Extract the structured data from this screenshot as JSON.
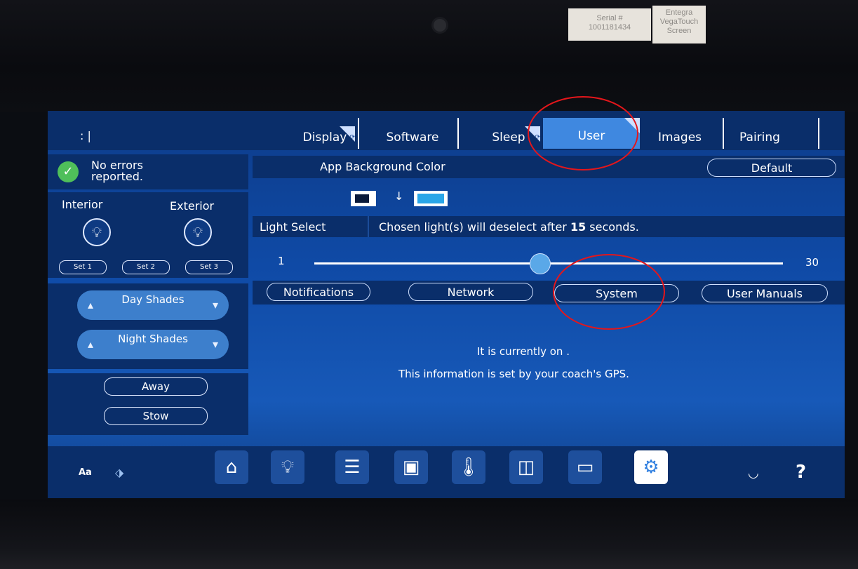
{
  "stickers": {
    "serial_label": "Serial #",
    "serial_number": "1001181434",
    "model_line1": "Entegra",
    "model_line2": "VegaTouch",
    "model_line3": "Screen"
  },
  "header": {
    "clock_text": ":       |"
  },
  "status": {
    "text": "No errors reported."
  },
  "lights": {
    "interior_label": "Interior",
    "exterior_label": "Exterior",
    "set_buttons": [
      "Set 1",
      "Set 2",
      "Set 3"
    ]
  },
  "shades": {
    "day_label": "Day Shades",
    "night_label": "Night Shades"
  },
  "modes": {
    "away_label": "Away",
    "stow_label": "Stow"
  },
  "tabs": [
    {
      "label": "Display"
    },
    {
      "label": "Software"
    },
    {
      "label": "Sleep"
    },
    {
      "label": "User"
    },
    {
      "label": "Images"
    },
    {
      "label": "Pairing"
    }
  ],
  "active_tab": "User",
  "background": {
    "label": "App Background Color",
    "default_button": "Default",
    "from_color": "#0a1a3a",
    "to_color": "#2aa6e8",
    "arrow": "↓"
  },
  "light_select": {
    "label": "Light Select",
    "message_prefix": "Chosen light(s) will deselect after ",
    "seconds": "15",
    "message_suffix": " seconds.",
    "slider_min": "1",
    "slider_max": "30",
    "slider_value": 15
  },
  "subtabs": [
    "Notifications",
    "Network",
    "System",
    "User Manuals"
  ],
  "info": {
    "line1": "It is currently on .",
    "line2": "This information is set by your coach's GPS."
  },
  "toolbar": {
    "font_label": "Aa",
    "items": [
      "home-icon",
      "lightbulb-icon",
      "shade-icon",
      "coach-icon",
      "thermometer-icon",
      "tank-icon",
      "generator-icon",
      "settings-icon"
    ],
    "active_item": "settings-icon",
    "sleep_icon": "closed-eye-icon",
    "help_label": "?"
  },
  "colors": {
    "screen_blue": "#0f4aa6",
    "panel_dark": "#0a2e6a",
    "active_tab": "#3f88e0",
    "status_green": "#4fbf5a",
    "annotation_red": "#e4161b"
  }
}
